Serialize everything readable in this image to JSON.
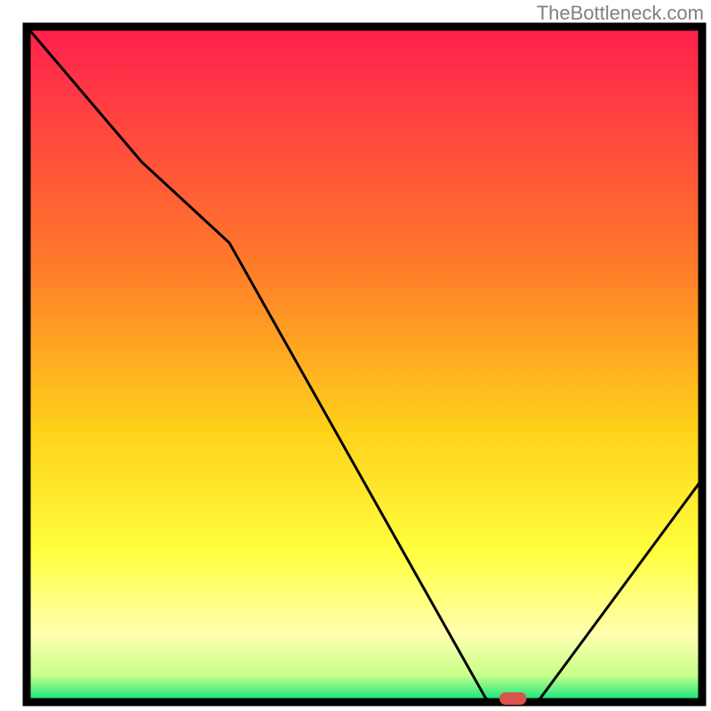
{
  "attribution": "TheBottleneck.com",
  "chart_data": {
    "type": "line",
    "title": "",
    "xlabel": "",
    "ylabel": "",
    "xlim": [
      0,
      100
    ],
    "ylim": [
      0,
      100
    ],
    "x": [
      0,
      17,
      30,
      68,
      70,
      74,
      76,
      100
    ],
    "values": [
      100,
      80,
      68,
      0.5,
      0,
      0,
      0.5,
      33
    ],
    "marker": {
      "x_start": 70,
      "x_end": 74,
      "y": 0
    },
    "gradient_stops": [
      {
        "offset": 0,
        "color": "#ff1f4e"
      },
      {
        "offset": 0.35,
        "color": "#ff7a2a"
      },
      {
        "offset": 0.6,
        "color": "#ffd21a"
      },
      {
        "offset": 0.78,
        "color": "#ffff40"
      },
      {
        "offset": 0.9,
        "color": "#ffffb0"
      },
      {
        "offset": 0.96,
        "color": "#c8ff8a"
      },
      {
        "offset": 1.0,
        "color": "#00e37a"
      }
    ],
    "border_color": "#000000",
    "line_color": "#000000",
    "marker_color": "#d9534f"
  }
}
